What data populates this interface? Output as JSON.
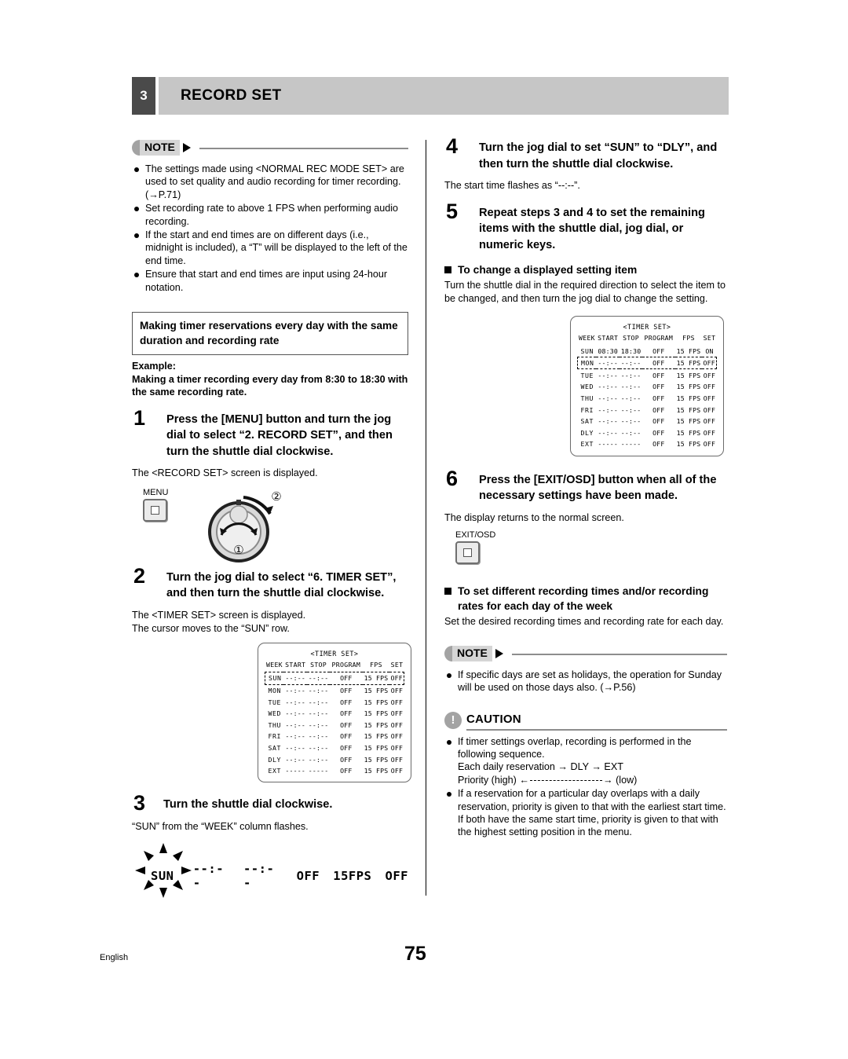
{
  "header": {
    "number": "3",
    "title": "RECORD SET"
  },
  "left": {
    "note": {
      "label": "NOTE",
      "items": [
        "The settings made using <NORMAL REC MODE SET> are used to set quality and audio recording for timer recording. (→P.71)",
        "Set recording rate to above 1 FPS when performing audio recording.",
        "If the start and end times are on different days (i.e., midnight is included), a “T” will be displayed to the left of the end time.",
        "Ensure that start and end times are input using 24-hour notation."
      ]
    },
    "boxed_heading": "Making timer reservations every day with the same duration and recording rate",
    "example_label": "Example:",
    "example_text": "Making a timer recording every day from 8:30 to 18:30 with the same recording rate.",
    "step1": {
      "number": "1",
      "title": "Press the [MENU] button and turn the jog dial to select “2. RECORD SET”, and then turn the shuttle dial clockwise.",
      "sub": "The <RECORD SET> screen is displayed."
    },
    "menu_figure": {
      "button_label": "MENU",
      "callout_jog": "①",
      "callout_shuttle": "②"
    },
    "step2": {
      "number": "2",
      "title": "Turn the jog dial to select “6. TIMER SET”, and then turn the shuttle dial clockwise.",
      "sub1": "The <TIMER SET> screen is displayed.",
      "sub2": "The cursor moves to the “SUN” row."
    },
    "timer_table": {
      "caption": "<TIMER SET>",
      "columns": [
        "WEEK",
        "START",
        "STOP",
        "PROGRAM",
        "FPS",
        "SET"
      ],
      "cursor_row": 0,
      "rows": [
        [
          "SUN",
          "--:--",
          "--:--",
          "OFF",
          "15 FPS",
          "OFF"
        ],
        [
          "MON",
          "--:--",
          "--:--",
          "OFF",
          "15 FPS",
          "OFF"
        ],
        [
          "TUE",
          "--:--",
          "--:--",
          "OFF",
          "15 FPS",
          "OFF"
        ],
        [
          "WED",
          "--:--",
          "--:--",
          "OFF",
          "15 FPS",
          "OFF"
        ],
        [
          "THU",
          "--:--",
          "--:--",
          "OFF",
          "15 FPS",
          "OFF"
        ],
        [
          "FRI",
          "--:--",
          "--:--",
          "OFF",
          "15 FPS",
          "OFF"
        ],
        [
          "SAT",
          "--:--",
          "--:--",
          "OFF",
          "15 FPS",
          "OFF"
        ],
        [
          "DLY",
          "--:--",
          "--:--",
          "OFF",
          "15 FPS",
          "OFF"
        ],
        [
          "EXT",
          "-----",
          "-----",
          "OFF",
          "15 FPS",
          "OFF"
        ]
      ]
    },
    "step3": {
      "number": "3",
      "title": "Turn the shuttle dial clockwise.",
      "sub": "“SUN” from the “WEEK” column flashes."
    },
    "flash_row": {
      "week": "SUN",
      "start": "--:--",
      "stop": "--:--",
      "program": "OFF",
      "fps": "15FPS",
      "set": "OFF"
    }
  },
  "right": {
    "step4": {
      "number": "4",
      "title": "Turn the jog dial to set “SUN” to “DLY”, and then turn the shuttle dial clockwise.",
      "sub": "The start time flashes as “--:--”."
    },
    "step5": {
      "number": "5",
      "title": "Repeat steps 3 and 4 to set the remaining items with the shuttle dial, jog dial, or numeric keys."
    },
    "sq1_heading": "To change a displayed setting item",
    "sq1_text": "Turn the shuttle dial in the required direction to select the item to be changed, and then turn the jog dial to change the setting.",
    "timer_table": {
      "caption": "<TIMER SET>",
      "columns": [
        "WEEK",
        "START",
        "STOP",
        "PROGRAM",
        "FPS",
        "SET"
      ],
      "cursor_row": 1,
      "rows": [
        [
          "SUN",
          "08:30",
          "18:30",
          "OFF",
          "15 FPS",
          "ON"
        ],
        [
          "MON",
          "--:--",
          "--:--",
          "OFF",
          "15 FPS",
          "OFF"
        ],
        [
          "TUE",
          "--:--",
          "--:--",
          "OFF",
          "15 FPS",
          "OFF"
        ],
        [
          "WED",
          "--:--",
          "--:--",
          "OFF",
          "15 FPS",
          "OFF"
        ],
        [
          "THU",
          "--:--",
          "--:--",
          "OFF",
          "15 FPS",
          "OFF"
        ],
        [
          "FRI",
          "--:--",
          "--:--",
          "OFF",
          "15 FPS",
          "OFF"
        ],
        [
          "SAT",
          "--:--",
          "--:--",
          "OFF",
          "15 FPS",
          "OFF"
        ],
        [
          "DLY",
          "--:--",
          "--:--",
          "OFF",
          "15 FPS",
          "OFF"
        ],
        [
          "EXT",
          "-----",
          "-----",
          "OFF",
          "15 FPS",
          "OFF"
        ]
      ]
    },
    "step6": {
      "number": "6",
      "title": "Press the [EXIT/OSD] button when all of the necessary settings have been made.",
      "sub": "The display returns to the normal screen."
    },
    "exitosd_figure": {
      "button_label": "EXIT/OSD"
    },
    "sq2_heading": "To set different recording times and/or recording rates for each day of the week",
    "sq2_text": "Set the desired recording times and recording rate for each day.",
    "note": {
      "label": "NOTE",
      "items": [
        "If specific days are set as holidays, the operation for Sunday will be used on those days also. (→P.56)"
      ]
    },
    "caution": {
      "label": "CAUTION",
      "icon": "!",
      "item1_line1": "If timer settings overlap, recording is performed in the following sequence.",
      "item1_line2": "Each daily reservation → DLY → EXT",
      "item1_priority_high": "Priority (high) ←",
      "item1_priority_low": "→ (low)",
      "item2": "If a reservation for a particular day overlaps with a daily reservation, priority is given to that with the earliest start time. If both have the same start time, priority is given to that with the highest setting position in the menu."
    }
  },
  "footer": {
    "language": "English",
    "page": "75"
  }
}
